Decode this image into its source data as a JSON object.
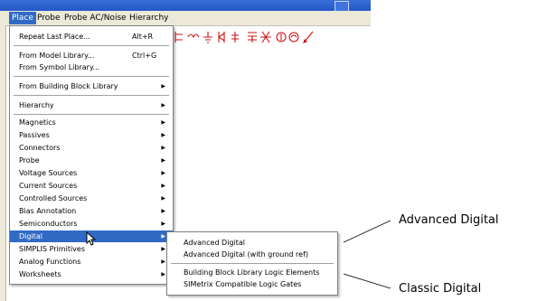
{
  "menubar": {
    "items": [
      {
        "label": "Place",
        "active": true
      },
      {
        "label": "Probe"
      },
      {
        "label": "Probe AC/Noise"
      },
      {
        "label": "Hierarchy"
      }
    ]
  },
  "place_menu": {
    "repeat_last": {
      "label": "Repeat Last Place...",
      "shortcut": "Alt+R"
    },
    "from_model": {
      "label": "From Model Library...",
      "shortcut": "Ctrl+G"
    },
    "from_symbol": {
      "label": "From Symbol Library..."
    },
    "from_building_block": {
      "label": "From Building Block Library"
    },
    "hierarchy": {
      "label": "Hierarchy"
    },
    "categories": [
      "Magnetics",
      "Passives",
      "Connectors",
      "Probe",
      "Voltage Sources",
      "Current Sources",
      "Controlled Sources",
      "Bias Annotation",
      "Semiconductors",
      "Digital",
      "SIMPLIS Primitives",
      "Analog Functions",
      "Worksheets"
    ],
    "selected": "Digital"
  },
  "digital_submenu": {
    "advanced": [
      "Advanced Digital",
      "Advanced Digital (with ground ref)"
    ],
    "classic": [
      "Building Block Library Logic Elements",
      "SIMetrix Compatible Logic Gates"
    ]
  },
  "callouts": {
    "advanced": "Advanced Digital",
    "classic": "Classic Digital"
  },
  "colors": {
    "menu_highlight": "#316ac5",
    "menubar": "#ece9d8",
    "toolbar_icons": "#cc1111"
  }
}
